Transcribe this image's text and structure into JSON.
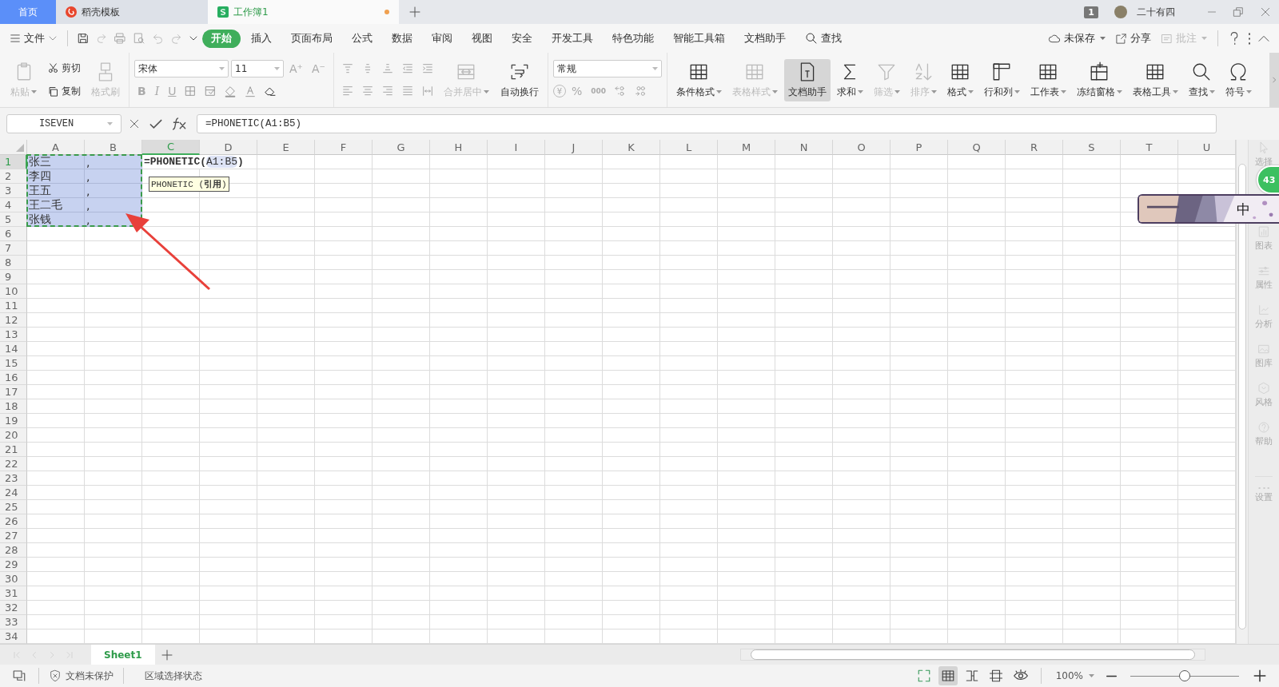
{
  "tabs": [
    {
      "label": "首页",
      "kind": "home",
      "selected": false
    },
    {
      "label": "稻壳模板",
      "kind": "docer",
      "selected": false
    },
    {
      "label": "工作簿1",
      "kind": "sheet",
      "selected": true,
      "unsaved": true
    }
  ],
  "title_bar": {
    "window_count": "1",
    "user": "二十有四"
  },
  "menu": {
    "file": "文件",
    "items": [
      {
        "label": "开始",
        "selected": true
      },
      {
        "label": "插入",
        "selected": false
      },
      {
        "label": "页面布局",
        "selected": false
      },
      {
        "label": "公式",
        "selected": false
      },
      {
        "label": "数据",
        "selected": false
      },
      {
        "label": "审阅",
        "selected": false
      },
      {
        "label": "视图",
        "selected": false
      },
      {
        "label": "安全",
        "selected": false
      },
      {
        "label": "开发工具",
        "selected": false
      },
      {
        "label": "特色功能",
        "selected": false
      },
      {
        "label": "智能工具箱",
        "selected": false
      },
      {
        "label": "文档助手",
        "selected": false
      }
    ],
    "search": "查找",
    "save_state": "未保存",
    "share": "分享",
    "comment": {
      "label": "批注",
      "disabled": true
    }
  },
  "ribbon": {
    "clipboard": [
      {
        "label": "粘贴",
        "kind": "paste",
        "disabled": true,
        "dropdown": true
      },
      {
        "label": "剪切",
        "kind": "cut",
        "disabled": false,
        "dropdown": false
      },
      {
        "label": "复制",
        "kind": "copy",
        "disabled": false,
        "dropdown": false
      },
      {
        "label": "格式刷",
        "kind": "brush",
        "disabled": true,
        "dropdown": false
      }
    ],
    "font_name": "宋体",
    "font_size": "11",
    "size_buttons": [
      "A⁺",
      "A⁻"
    ],
    "style_buttons": [
      "B",
      "I",
      "U"
    ],
    "merge": {
      "label": "合并居中",
      "disabled": true,
      "dropdown": true
    },
    "wrap": {
      "label": "自动换行",
      "disabled": false,
      "dropdown": false
    },
    "number_format": "常规",
    "number_buttons": [
      {
        "label": "¥",
        "kind": "currency"
      },
      {
        "label": "%",
        "kind": "plain"
      },
      {
        "label": "000",
        "kind": "small"
      }
    ],
    "tools": [
      {
        "label": "条件格式",
        "kind": "table",
        "disabled": false,
        "dropdown": true,
        "selected": false
      },
      {
        "label": "表格样式",
        "kind": "table",
        "disabled": true,
        "dropdown": true,
        "selected": false
      },
      {
        "label": "文档助手",
        "kind": "doc",
        "disabled": false,
        "dropdown": false,
        "selected": true
      },
      {
        "label": "求和",
        "kind": "sigma",
        "disabled": false,
        "dropdown": true,
        "selected": false
      },
      {
        "label": "筛选",
        "kind": "funnel",
        "disabled": true,
        "dropdown": true,
        "selected": false
      },
      {
        "label": "排序",
        "kind": "sort",
        "disabled": true,
        "dropdown": true,
        "selected": false
      },
      {
        "label": "格式",
        "kind": "table",
        "disabled": false,
        "dropdown": true,
        "selected": false
      },
      {
        "label": "行和列",
        "kind": "rowcol",
        "disabled": false,
        "dropdown": true,
        "selected": false
      },
      {
        "label": "工作表",
        "kind": "table",
        "disabled": false,
        "dropdown": true,
        "selected": false
      },
      {
        "label": "冻结窗格",
        "kind": "freeze",
        "disabled": false,
        "dropdown": true,
        "selected": false
      },
      {
        "label": "表格工具",
        "kind": "table",
        "disabled": false,
        "dropdown": true,
        "selected": false
      },
      {
        "label": "查找",
        "kind": "search",
        "disabled": false,
        "dropdown": true,
        "selected": false
      },
      {
        "label": "符号",
        "kind": "omega",
        "disabled": false,
        "dropdown": true,
        "selected": false
      }
    ]
  },
  "formula_bar": {
    "name_box": "ISEVEN",
    "formula": "=PHONETIC(A1:B5)"
  },
  "grid": {
    "columns": [
      {
        "label": "A",
        "selected": false
      },
      {
        "label": "B",
        "selected": false
      },
      {
        "label": "C",
        "selected": true
      },
      {
        "label": "D",
        "selected": false
      },
      {
        "label": "E",
        "selected": false
      },
      {
        "label": "F",
        "selected": false
      },
      {
        "label": "G",
        "selected": false
      },
      {
        "label": "H",
        "selected": false
      },
      {
        "label": "I",
        "selected": false
      },
      {
        "label": "J",
        "selected": false
      },
      {
        "label": "K",
        "selected": false
      },
      {
        "label": "L",
        "selected": false
      },
      {
        "label": "M",
        "selected": false
      },
      {
        "label": "N",
        "selected": false
      },
      {
        "label": "O",
        "selected": false
      },
      {
        "label": "P",
        "selected": false
      },
      {
        "label": "Q",
        "selected": false
      },
      {
        "label": "R",
        "selected": false
      },
      {
        "label": "S",
        "selected": false
      },
      {
        "label": "T",
        "selected": false
      },
      {
        "label": "U",
        "selected": false
      }
    ],
    "rows": [
      {
        "header": "1",
        "selected": true,
        "cells": [
          {
            "text": "张三",
            "selected": true
          },
          {
            "text": ",",
            "selected": true
          }
        ]
      },
      {
        "header": "2",
        "selected": false,
        "cells": [
          {
            "text": "李四",
            "selected": true
          },
          {
            "text": ",",
            "selected": true
          }
        ]
      },
      {
        "header": "3",
        "selected": false,
        "cells": [
          {
            "text": "王五",
            "selected": true
          },
          {
            "text": ",",
            "selected": true
          }
        ]
      },
      {
        "header": "4",
        "selected": false,
        "cells": [
          {
            "text": "王二毛",
            "selected": true
          },
          {
            "text": ",",
            "selected": true
          }
        ]
      },
      {
        "header": "5",
        "selected": false,
        "cells": [
          {
            "text": "张钱",
            "selected": true
          },
          {
            "text": ",",
            "selected": true
          }
        ]
      },
      {
        "header": "6",
        "selected": false
      },
      {
        "header": "7",
        "selected": false
      },
      {
        "header": "8",
        "selected": false
      },
      {
        "header": "9",
        "selected": false
      },
      {
        "header": "10",
        "selected": false
      },
      {
        "header": "11",
        "selected": false
      },
      {
        "header": "12",
        "selected": false
      },
      {
        "header": "13",
        "selected": false
      },
      {
        "header": "14",
        "selected": false
      },
      {
        "header": "15",
        "selected": false
      },
      {
        "header": "16",
        "selected": false
      },
      {
        "header": "17",
        "selected": false
      },
      {
        "header": "18",
        "selected": false
      },
      {
        "header": "19",
        "selected": false
      },
      {
        "header": "20",
        "selected": false
      },
      {
        "header": "21",
        "selected": false
      },
      {
        "header": "22",
        "selected": false
      },
      {
        "header": "23",
        "selected": false
      },
      {
        "header": "24",
        "selected": false
      },
      {
        "header": "25",
        "selected": false
      },
      {
        "header": "26",
        "selected": false
      },
      {
        "header": "27",
        "selected": false
      },
      {
        "header": "28",
        "selected": false
      },
      {
        "header": "29",
        "selected": false
      },
      {
        "header": "30",
        "selected": false
      },
      {
        "header": "31",
        "selected": false
      },
      {
        "header": "32",
        "selected": false
      },
      {
        "header": "33",
        "selected": false
      },
      {
        "header": "34",
        "selected": false
      }
    ],
    "editor": {
      "before": "=PHONETIC(",
      "ref": "A1:B5",
      "after": ")",
      "hint": "PHONETIC (**引用**)"
    }
  },
  "side_panel": [
    {
      "label": "选择"
    },
    {
      "label": "图表"
    },
    {
      "label": "属性"
    },
    {
      "label": "分析"
    },
    {
      "label": "图库"
    },
    {
      "label": "风格"
    },
    {
      "label": "帮助"
    },
    {
      "label": "设置"
    }
  ],
  "badge": "43",
  "ime": {
    "mode": "中"
  },
  "sheet_tabs": [
    {
      "label": "Sheet1",
      "selected": true
    }
  ],
  "status_bar": {
    "protection": "文档未保护",
    "mode": "区域选择状态",
    "zoom": "100%",
    "zoom_level": {
      "level": 0.5
    }
  }
}
